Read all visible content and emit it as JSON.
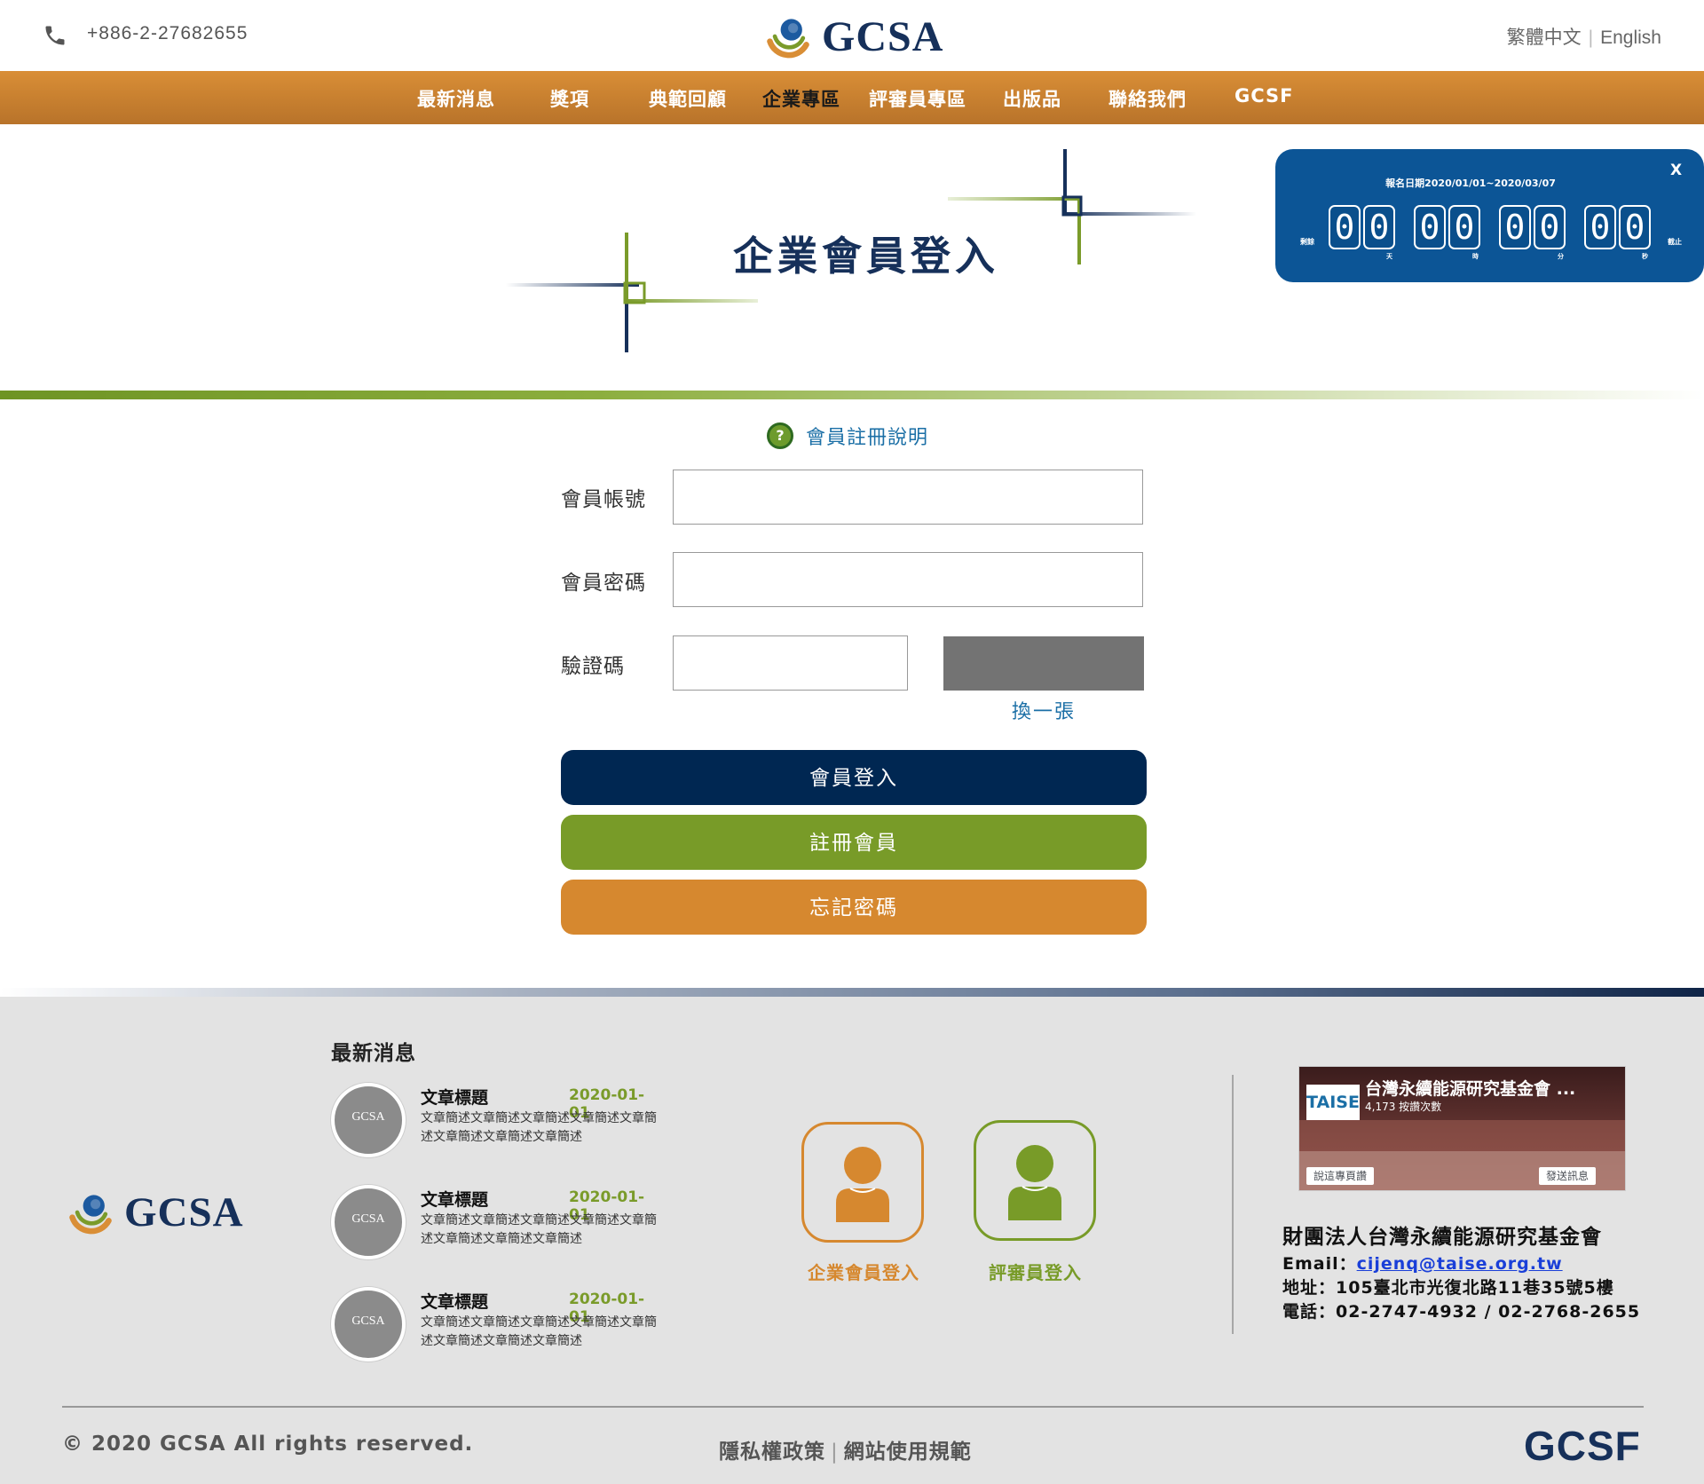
{
  "header": {
    "phone": "+886-2-27682655",
    "logo_text": "GCSA",
    "lang_zh": "繁體中文",
    "lang_en": "English"
  },
  "nav": {
    "items": [
      {
        "label": "最新消息"
      },
      {
        "label": "獎項"
      },
      {
        "label": "典範回顧"
      },
      {
        "label": "企業專區",
        "active": true
      },
      {
        "label": "評審員專區"
      },
      {
        "label": "出版品"
      },
      {
        "label": "聯絡我們"
      },
      {
        "label": "GCSF"
      }
    ]
  },
  "banner": {
    "title": "企業會員登入"
  },
  "countdown": {
    "date_range": "報名日期2020/01/01~2020/03/07",
    "close_label": "X",
    "prefix": "剩餘",
    "suffix": "截止",
    "units": [
      {
        "label": "天",
        "digits": [
          "0",
          "0"
        ]
      },
      {
        "label": "時",
        "digits": [
          "0",
          "0"
        ]
      },
      {
        "label": "分",
        "digits": [
          "0",
          "0"
        ]
      },
      {
        "label": "秒",
        "digits": [
          "0",
          "0"
        ]
      }
    ]
  },
  "login": {
    "help_label": "會員註冊說明",
    "account_label": "會員帳號",
    "account_value": "",
    "password_label": "會員密碼",
    "password_value": "",
    "captcha_label": "驗證碼",
    "captcha_value": "",
    "refresh_label": "換一張",
    "login_button": "會員登入",
    "register_button": "註冊會員",
    "forgot_button": "忘記密碼"
  },
  "footer": {
    "logo_text": "GCSA",
    "news_title": "最新消息",
    "news": [
      {
        "thumb": "GCSA",
        "title": "文章標題",
        "date": "2020-01-01",
        "desc": "文章簡述文章簡述文章簡述文章簡述文章簡述文章簡述文章簡述文章簡述"
      },
      {
        "thumb": "GCSA",
        "title": "文章標題",
        "date": "2020-01-01",
        "desc": "文章簡述文章簡述文章簡述文章簡述文章簡述文章簡述文章簡述文章簡述"
      },
      {
        "thumb": "GCSA",
        "title": "文章標題",
        "date": "2020-01-01",
        "desc": "文章簡述文章簡述文章簡述文章簡述文章簡述文章簡述文章簡述文章簡述"
      }
    ],
    "enterprise_login": "企業會員登入",
    "judge_login": "評審員登入",
    "fb": {
      "logo": "TAISE",
      "title": "台灣永續能源研究基金會 ...",
      "likes": "4,173 按讚次數",
      "like_button": "說這專頁讚",
      "message_button": "發送訊息"
    },
    "org_name": "財團法人台灣永續能源研究基金會",
    "email_label": "Email：",
    "email": "cijenq@taise.org.tw",
    "address": "地址：105臺北市光復北路11巷35號5樓",
    "tel": "電話：02-2747-4932 / 02-2768-2655",
    "copyright": "© 2020 GCSA All rights reserved.",
    "privacy": "隱私權政策",
    "terms": "網站使用規範",
    "gcsf": "GCSF"
  },
  "colors": {
    "navy": "#002752",
    "green": "#789b28",
    "orange": "#d6882f",
    "nav_orange": "#c98030",
    "countdown_blue": "#0c5596"
  }
}
